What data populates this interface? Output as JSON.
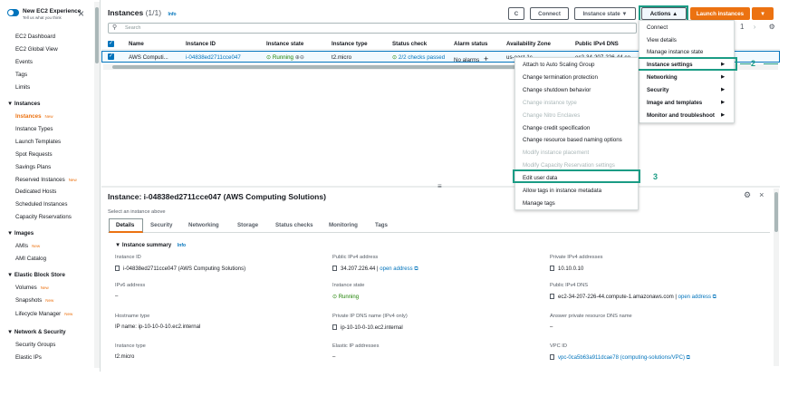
{
  "sidebar": {
    "toggle_title": "New EC2 Experience",
    "toggle_sub": "Tell us what you think",
    "items": [
      {
        "label": "EC2 Dashboard",
        "type": "item"
      },
      {
        "label": "EC2 Global View",
        "type": "item"
      },
      {
        "label": "Events",
        "type": "item"
      },
      {
        "label": "Tags",
        "type": "item"
      },
      {
        "label": "Limits",
        "type": "item"
      },
      {
        "label": "Instances",
        "type": "head"
      },
      {
        "label": "Instances",
        "type": "item",
        "active": true,
        "badge": "New"
      },
      {
        "label": "Instance Types",
        "type": "item"
      },
      {
        "label": "Launch Templates",
        "type": "item"
      },
      {
        "label": "Spot Requests",
        "type": "item"
      },
      {
        "label": "Savings Plans",
        "type": "item"
      },
      {
        "label": "Reserved Instances",
        "type": "item",
        "badge": "New"
      },
      {
        "label": "Dedicated Hosts",
        "type": "item"
      },
      {
        "label": "Scheduled Instances",
        "type": "item"
      },
      {
        "label": "Capacity Reservations",
        "type": "item"
      },
      {
        "label": "Images",
        "type": "head"
      },
      {
        "label": "AMIs",
        "type": "item",
        "badge": "New"
      },
      {
        "label": "AMI Catalog",
        "type": "item"
      },
      {
        "label": "Elastic Block Store",
        "type": "head"
      },
      {
        "label": "Volumes",
        "type": "item",
        "badge": "New"
      },
      {
        "label": "Snapshots",
        "type": "item",
        "badge": "New"
      },
      {
        "label": "Lifecycle Manager",
        "type": "item",
        "badge": "New"
      },
      {
        "label": "Network & Security",
        "type": "head"
      },
      {
        "label": "Security Groups",
        "type": "item"
      },
      {
        "label": "Elastic IPs",
        "type": "item"
      }
    ]
  },
  "instances": {
    "title": "Instances",
    "count": "(1/1)",
    "info": "Info",
    "buttons": {
      "refresh": "C",
      "connect": "Connect",
      "instance_state": "Instance state ▼",
      "actions": "Actions ▲",
      "launch": "Launch instances",
      "launch_arrow": "▼"
    },
    "search_placeholder": "Search",
    "columns": [
      "Name",
      "Instance ID",
      "Instance state",
      "Instance type",
      "Status check",
      "Alarm status",
      "Availability Zone",
      "Public IPv4 DNS"
    ],
    "row": {
      "name": "AWS Computi...",
      "instance_id": "i-04838ed2711cce047",
      "state": "Running",
      "type": "t2.micro",
      "status": "2/2 checks passed",
      "alarm": "No alarms",
      "az": "us-east-1c",
      "dns": "ec2-34-207-226-44.co"
    },
    "pager": "1"
  },
  "actions_menu": [
    "Connect",
    "View details",
    "Manage instance state",
    "Instance settings",
    "Networking",
    "Security",
    "Image and templates",
    "Monitor and troubleshoot"
  ],
  "settings_menu": [
    {
      "label": "Attach to Auto Scaling Group",
      "disabled": false
    },
    {
      "label": "Change termination protection",
      "disabled": false
    },
    {
      "label": "Change shutdown behavior",
      "disabled": false
    },
    {
      "label": "Change instance type",
      "disabled": true
    },
    {
      "label": "Change Nitro Enclaves",
      "disabled": true
    },
    {
      "label": "Change credit specification",
      "disabled": false
    },
    {
      "label": "Change resource based naming options",
      "disabled": false
    },
    {
      "label": "Modify instance placement",
      "disabled": true
    },
    {
      "label": "Modify Capacity Reservation settings",
      "disabled": true
    },
    {
      "label": "Edit user data",
      "disabled": false
    },
    {
      "label": "Allow tags in instance metadata",
      "disabled": false
    },
    {
      "label": "Manage tags",
      "disabled": false
    }
  ],
  "callouts": [
    "1",
    "2",
    "3"
  ],
  "details": {
    "title": "Instance: i-04838ed2711cce047 (AWS Computing Solutions)",
    "select_text": "Select an instance above",
    "tabs": [
      "Details",
      "Security",
      "Networking",
      "Storage",
      "Status checks",
      "Monitoring",
      "Tags"
    ],
    "summary": "Instance summary",
    "summary_info": "Info",
    "fields": [
      {
        "label": "Instance ID",
        "value": "i-04838ed2711cce047 (AWS Computing Solutions)",
        "copy": true
      },
      {
        "label": "Public IPv4 address",
        "value": "34.207.226.44",
        "link": "open address",
        "copy": true
      },
      {
        "label": "Private IPv4 addresses",
        "value": "10.10.0.10",
        "copy": true
      },
      {
        "label": "IPv6 address",
        "value": "–"
      },
      {
        "label": "Instance state",
        "value": "Running",
        "status": true
      },
      {
        "label": "Public IPv4 DNS",
        "value": "ec2-34-207-226-44.compute-1.amazonaws.com",
        "link": "open address",
        "copy": true
      },
      {
        "label": "Hostname type",
        "value": "IP name: ip-10-10-0-10.ec2.internal"
      },
      {
        "label": "Private IP DNS name (IPv4 only)",
        "value": "ip-10-10-0-10.ec2.internal",
        "copy": true
      },
      {
        "label": "Answer private resource DNS name",
        "value": "–"
      },
      {
        "label": "Instance type",
        "value": "t2.micro"
      },
      {
        "label": "Elastic IP addresses",
        "value": "–"
      },
      {
        "label": "VPC ID",
        "value": "vpc-0ca5b63a911dcae78 (computing-solutions/VPC)",
        "vpc_link": true,
        "copy": true
      }
    ]
  },
  "colors": {
    "accent": "#ec7211",
    "link": "#0073bb",
    "highlight": "#1b9c85",
    "success": "#1d8102"
  }
}
